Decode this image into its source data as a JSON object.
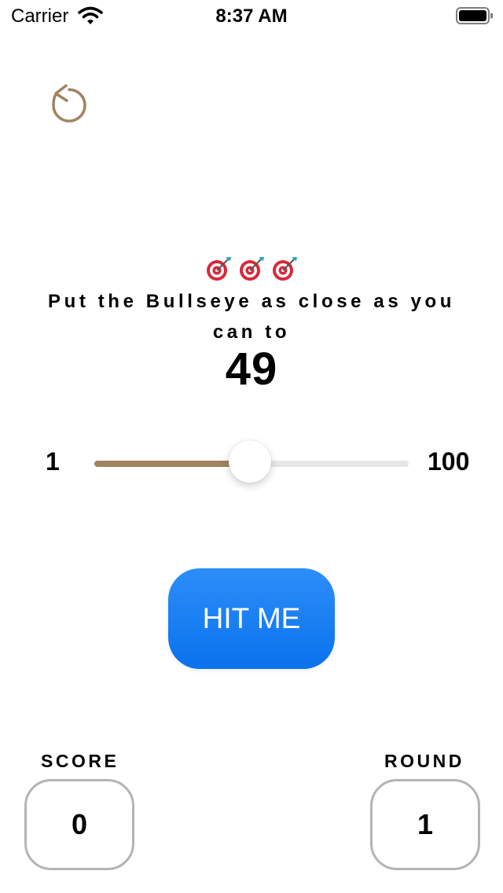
{
  "status_bar": {
    "carrier": "Carrier",
    "time": "8:37 AM"
  },
  "game": {
    "instruction": "Put the Bullseye as close as you can to",
    "target": "49",
    "slider": {
      "min_label": "1",
      "max_label": "100",
      "min": 1,
      "max": 100,
      "value": 50
    },
    "hit_button_label": "HIT ME",
    "score_label": "SCORE",
    "score_value": "0",
    "round_label": "ROUND",
    "round_value": "1"
  },
  "colors": {
    "accent_brown": "#a08460",
    "button_blue": "#0a72ee",
    "box_border": "#b4b4b4"
  },
  "icons": {
    "restart": "restart-icon",
    "darts": "dart-target-icon"
  }
}
